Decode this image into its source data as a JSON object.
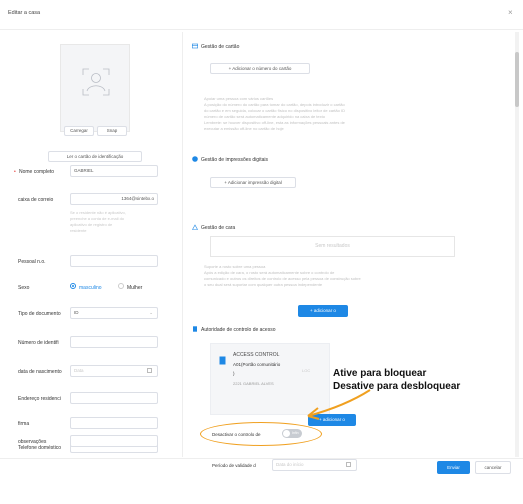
{
  "dialog": {
    "title": "Editar a casa"
  },
  "photo": {
    "upload_label": "Carregar",
    "snap_label": "Snap"
  },
  "left": {
    "read_card_label": "Ler o cartão de identificação",
    "fields": {
      "full_name": {
        "label": "Nome completo",
        "value": "GABRIEL"
      },
      "email": {
        "label": "caixa de correio",
        "value": "1364@sintebx.o"
      },
      "email_hint": [
        "Se o residente não é aplicativo,",
        "preenche a conta de e-mail do",
        "aplicativo de registro de",
        "residente"
      ],
      "personal_no": {
        "label": "Pessoal n.o."
      },
      "gender": {
        "label": "Sexo",
        "options": [
          "masculino",
          "Mulher"
        ]
      },
      "doc_type": {
        "label": "Tipo de documento",
        "value": "ID"
      },
      "doc_number": {
        "label": "Número de identifi"
      },
      "birth_date": {
        "label": "data de nascimento",
        "placeholder": "Data"
      },
      "address": {
        "label": "Endereço residenci"
      },
      "company": {
        "label": "firma"
      },
      "phone": {
        "label": "Telefone doméstico"
      },
      "notes": {
        "label": "observações"
      }
    }
  },
  "right": {
    "card": {
      "title": "Gestão de cartão",
      "add_label": "+ Adicionar o número do cartão",
      "notes": [
        "Apoiar uma pessoa com vários cartões",
        "A posição do número do cartão para tomar do cartão, depois introduzir o cartão",
        "do cartão e em seguida, colocar o cartão físico no dispositivo leitor de cartão ID",
        "número de cartão será automaticamente adquirido na caixa de texto",
        "Lembrete: se houver dispositivo off-line, esta as informações pessoais antes de",
        "executar a emissão off-line no cartão de hoje"
      ]
    },
    "fingerprint": {
      "title": "Gestão de impressões digitais",
      "add_label": "+ Adicionar impressão digital"
    },
    "face": {
      "title": "Gestão de cara",
      "no_records": "Sem resultados",
      "notes": [
        "Suporte a rosto sobre uma pessoa",
        "Após a edição de cara, o rosto será automaticamente sobre o controlo de",
        "comunicado e outros os direitos de controlo de acesso pela pessoa de construção sobre",
        "o seu dual será suportar com qualquer outra pessoa independente"
      ],
      "add_label": "+ adicionar o"
    },
    "access": {
      "title": "Autoridade de controlo de acesso",
      "device_title": "ACCESS CONTROL",
      "device_line": "A01(Portão comunitário",
      "device_line2": ")",
      "device_user": "2221 GABRIEL ALVES",
      "extra": "LOC",
      "add_label": "+ adicionar o",
      "disable_label": "Desactivar o controlo de",
      "toggle_label": "Infin",
      "validity_label": "Período de validade d",
      "validity_placeholder": "Data do início"
    },
    "annotation": {
      "line1": "Ative para bloquear",
      "line2": "Desative para desbloquear"
    }
  },
  "footer": {
    "confirm_label": "Enviar",
    "cancel_label": "cancelar"
  },
  "colors": {
    "accent": "#1e88e5",
    "annotation": "#f0a020"
  }
}
